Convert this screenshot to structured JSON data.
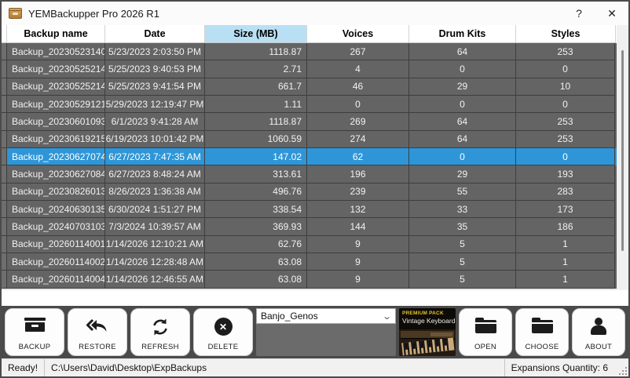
{
  "window": {
    "title": "YEMBackupper Pro 2026 R1",
    "help_label": "?",
    "close_label": "✕"
  },
  "table": {
    "columns": [
      {
        "label": "Backup name",
        "sorted": false
      },
      {
        "label": "Date",
        "sorted": false
      },
      {
        "label": "Size (MB)",
        "sorted": true
      },
      {
        "label": "Voices",
        "sorted": false
      },
      {
        "label": "Drum Kits",
        "sorted": false
      },
      {
        "label": "Styles",
        "sorted": false
      }
    ],
    "rows": [
      {
        "name": "Backup_20230523140...",
        "date": "5/23/2023 2:03:50 PM",
        "size": "1118.87",
        "voices": "267",
        "drums": "64",
        "styles": "253",
        "selected": false
      },
      {
        "name": "Backup_20230525214...",
        "date": "5/25/2023 9:40:53 PM",
        "size": "2.71",
        "voices": "4",
        "drums": "0",
        "styles": "0",
        "selected": false
      },
      {
        "name": "Backup_20230525214...",
        "date": "5/25/2023 9:41:54 PM",
        "size": "661.7",
        "voices": "46",
        "drums": "29",
        "styles": "10",
        "selected": false
      },
      {
        "name": "Backup_20230529121...",
        "date": "5/29/2023 12:19:47 PM",
        "size": "1.11",
        "voices": "0",
        "drums": "0",
        "styles": "0",
        "selected": false
      },
      {
        "name": "Backup_20230601093...",
        "date": "6/1/2023 9:41:28 AM",
        "size": "1118.87",
        "voices": "269",
        "drums": "64",
        "styles": "253",
        "selected": false
      },
      {
        "name": "Backup_20230619215...",
        "date": "6/19/2023 10:01:42 PM",
        "size": "1060.59",
        "voices": "274",
        "drums": "64",
        "styles": "253",
        "selected": false
      },
      {
        "name": "Backup_20230627074...",
        "date": "6/27/2023 7:47:35 AM",
        "size": "147.02",
        "voices": "62",
        "drums": "0",
        "styles": "0",
        "selected": true
      },
      {
        "name": "Backup_20230627084...",
        "date": "6/27/2023 8:48:24 AM",
        "size": "313.61",
        "voices": "196",
        "drums": "29",
        "styles": "193",
        "selected": false
      },
      {
        "name": "Backup_20230826013...",
        "date": "8/26/2023 1:36:38 AM",
        "size": "496.76",
        "voices": "239",
        "drums": "55",
        "styles": "283",
        "selected": false
      },
      {
        "name": "Backup_20240630135...",
        "date": "6/30/2024 1:51:27 PM",
        "size": "338.54",
        "voices": "132",
        "drums": "33",
        "styles": "173",
        "selected": false
      },
      {
        "name": "Backup_20240703103...",
        "date": "7/3/2024 10:39:57 AM",
        "size": "369.93",
        "voices": "144",
        "drums": "35",
        "styles": "186",
        "selected": false
      },
      {
        "name": "Backup_20260114001...",
        "date": "1/14/2026 12:10:21 AM",
        "size": "62.76",
        "voices": "9",
        "drums": "5",
        "styles": "1",
        "selected": false
      },
      {
        "name": "Backup_20260114002...",
        "date": "1/14/2026 12:28:48 AM",
        "size": "63.08",
        "voices": "9",
        "drums": "5",
        "styles": "1",
        "selected": false
      },
      {
        "name": "Backup_20260114004...",
        "date": "1/14/2026 12:46:55 AM",
        "size": "63.08",
        "voices": "9",
        "drums": "5",
        "styles": "1",
        "selected": false
      }
    ]
  },
  "toolbar": {
    "backup_label": "BACKUP",
    "restore_label": "RESTORE",
    "refresh_label": "REFRESH",
    "delete_label": "DELETE",
    "delete_glyph": "✕",
    "expansion_select": {
      "value": "Banjo_Genos",
      "arrow": "⌄"
    },
    "pack_badge": {
      "line1": "PREMIUM PACK",
      "line2": "Vintage Keyboard"
    },
    "open_label": "OPEN",
    "choose_label": "CHOOSE",
    "about_label": "ABOUT"
  },
  "statusbar": {
    "status": "Ready!",
    "path": "C:\\Users\\David\\Desktop\\ExpBackups",
    "right": "Expansions Quantity: 6"
  },
  "colors": {
    "selected_row": "#2e96d8",
    "sorted_header": "#b9dff4",
    "row_bg": "#646464",
    "toolbar_bg": "#4a4a4a",
    "pack_yellow": "#e8c229"
  }
}
